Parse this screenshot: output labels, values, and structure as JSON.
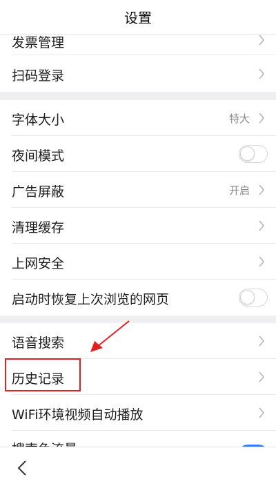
{
  "header": {
    "title": "设置"
  },
  "groups": [
    {
      "rows": [
        {
          "label": "发票管理",
          "control": "chevron"
        },
        {
          "label": "扫码登录",
          "control": "chevron"
        }
      ]
    },
    {
      "rows": [
        {
          "label": "字体大小",
          "value": "特大",
          "control": "chevron"
        },
        {
          "label": "夜间模式",
          "control": "toggle",
          "toggle_on": false
        },
        {
          "label": "广告屏蔽",
          "value": "开启",
          "control": "chevron"
        },
        {
          "label": "清理缓存",
          "control": "chevron"
        },
        {
          "label": "上网安全",
          "control": "chevron"
        },
        {
          "label": "启动时恢复上次浏览的网页",
          "control": "toggle",
          "toggle_on": false
        }
      ]
    },
    {
      "rows": [
        {
          "label": "语音搜索",
          "control": "chevron"
        },
        {
          "label": "历史记录",
          "control": "chevron",
          "highlighted": true
        },
        {
          "label": "WiFi环境视频自动播放",
          "control": "chevron"
        },
        {
          "label": "搜索色流量",
          "control": "toggle",
          "toggle_on": true
        }
      ]
    }
  ],
  "annotation": {
    "highlight_color": "#e02020",
    "arrow_color": "#e02020"
  },
  "icons": {
    "chevron": "chevron-right-icon",
    "back": "back-arrow-icon"
  },
  "colors": {
    "toggle_on": "#3b7cf5",
    "section_gap": "#efeff1"
  }
}
